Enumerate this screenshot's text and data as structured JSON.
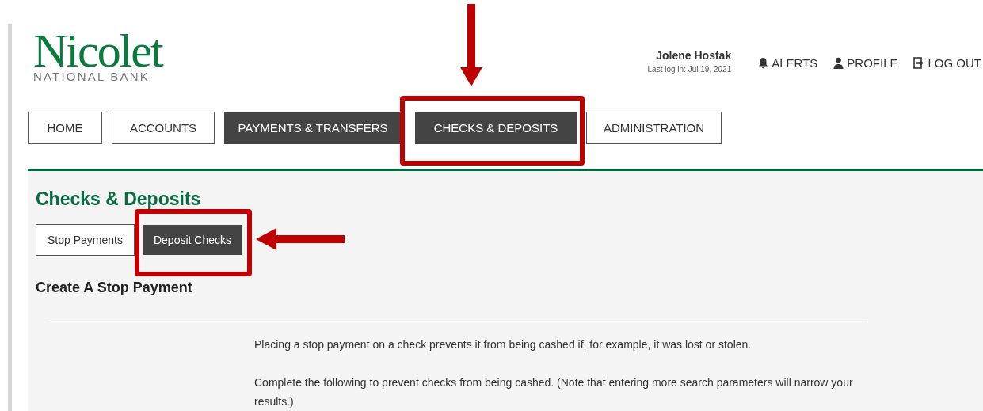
{
  "logo": {
    "name": "Nicolet",
    "subtitle": "NATIONAL BANK"
  },
  "user": {
    "name": "Jolene Hostak",
    "last_login": "Last log in: Jul 19, 2021"
  },
  "header_links": [
    {
      "kind": "bell",
      "label": "ALERTS"
    },
    {
      "kind": "person",
      "label": "PROFILE"
    },
    {
      "kind": "logout",
      "label": "LOG OUT"
    }
  ],
  "nav": [
    {
      "label": "HOME",
      "selected": false,
      "highlighted": false
    },
    {
      "label": "ACCOUNTS",
      "selected": false,
      "highlighted": false
    },
    {
      "label": "PAYMENTS & TRANSFERS",
      "selected": true,
      "highlighted": false
    },
    {
      "label": "CHECKS & DEPOSITS",
      "selected": true,
      "highlighted": true,
      "arrowed": true
    },
    {
      "label": "ADMINISTRATION",
      "selected": false,
      "highlighted": false
    }
  ],
  "page_title": "Checks & Deposits",
  "sub_tabs": [
    {
      "label": "Stop Payments",
      "selected": false,
      "highlighted": false
    },
    {
      "label": "Deposit Checks",
      "selected": true,
      "highlighted": true,
      "arrowed": true
    }
  ],
  "section_title": "Create A Stop Payment",
  "paragraphs": [
    "Placing a stop payment on a check prevents it from being cashed if, for example, it was lost or stolen.",
    "Complete the following to prevent checks from being cashed. (Note that entering more search parameters will narrow your results.)"
  ]
}
